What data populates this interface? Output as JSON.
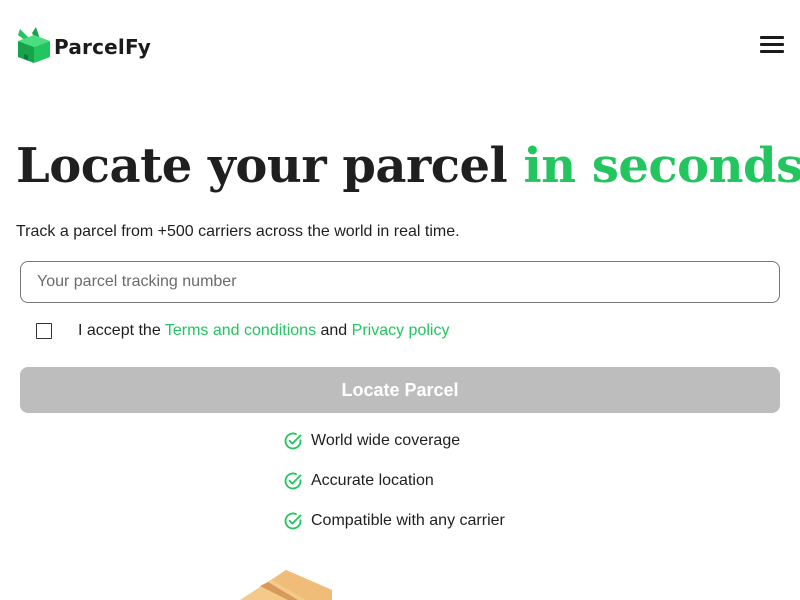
{
  "brand": {
    "name": "ParcelFy",
    "logo_icon": "parcel-box-icon",
    "accent_color": "#22c55e"
  },
  "header": {
    "menu_icon": "hamburger-menu-icon"
  },
  "hero": {
    "title_main": "Locate your parcel",
    "title_accent": "in seconds",
    "subtitle": "Track a parcel from +500 carriers across the world in real time."
  },
  "form": {
    "tracking_placeholder": "Your parcel tracking number",
    "tracking_value": "",
    "consent_prefix": "I accept the ",
    "terms_link": "Terms and conditions",
    "consent_and": " and ",
    "privacy_link": "Privacy policy",
    "consent_checked": false,
    "submit_label": "Locate Parcel",
    "submit_disabled": true
  },
  "features": [
    {
      "label": "World wide coverage",
      "icon": "check-circle-icon"
    },
    {
      "label": "Accurate location",
      "icon": "check-circle-icon"
    },
    {
      "label": "Compatible with any carrier",
      "icon": "check-circle-icon"
    }
  ],
  "illustration": {
    "icon": "cardboard-box-illustration"
  }
}
